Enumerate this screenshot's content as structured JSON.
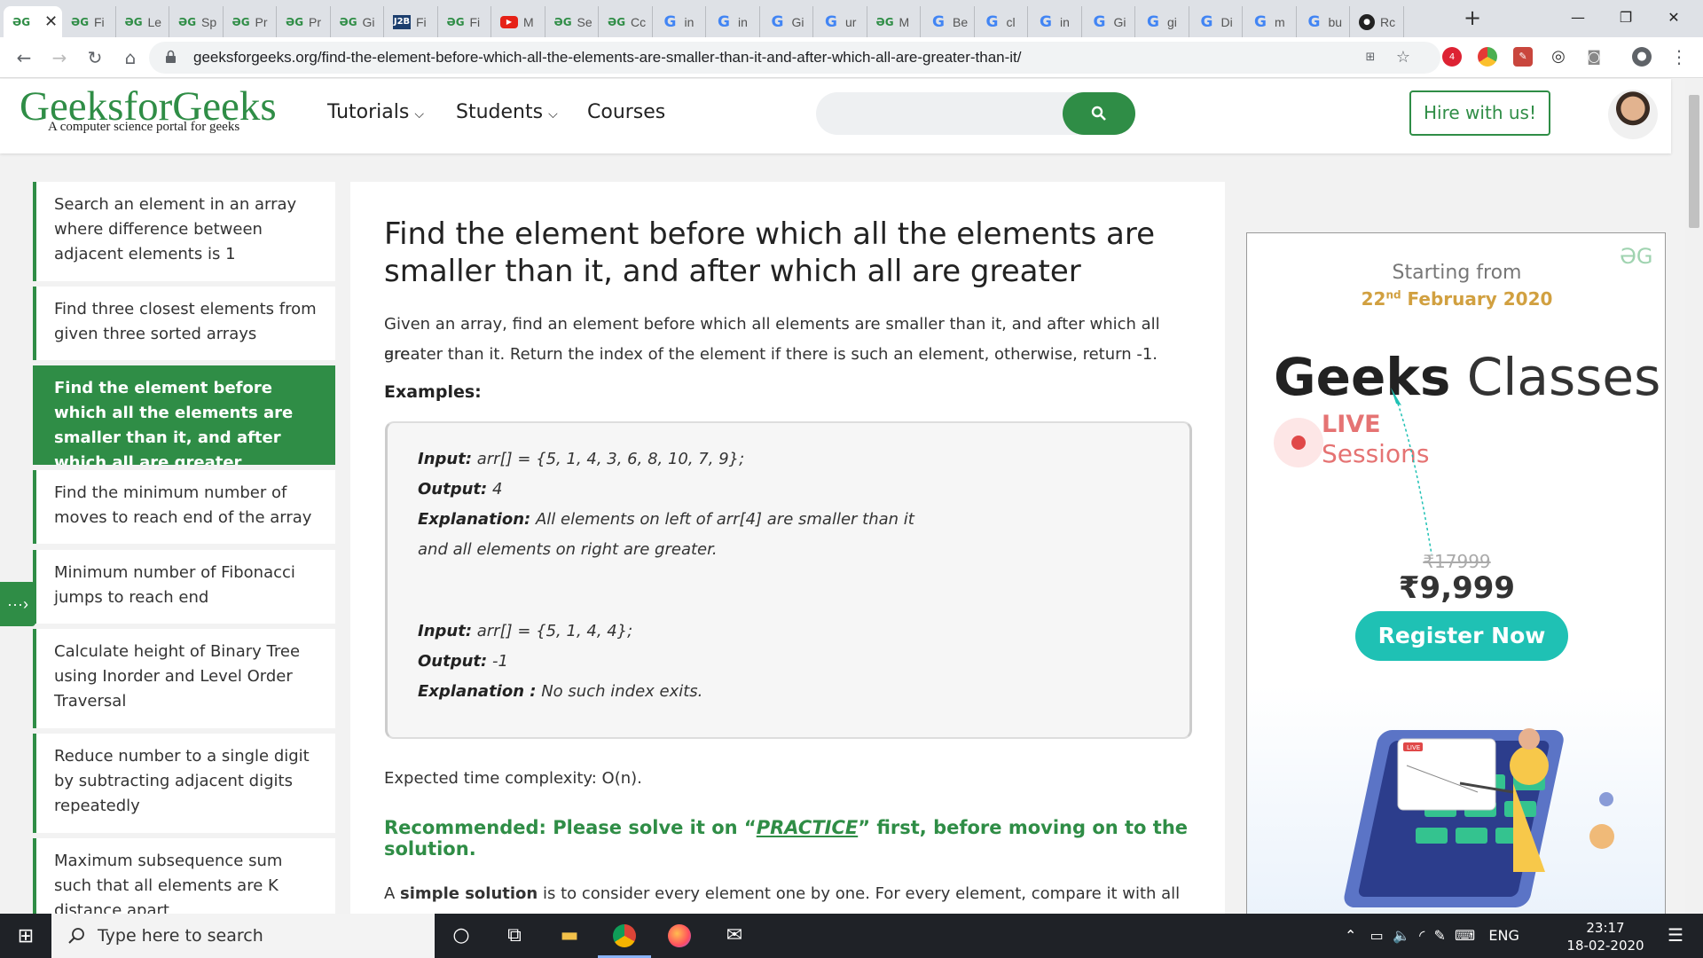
{
  "browser": {
    "tabs": [
      {
        "favicon": "gfg-icon",
        "title": "GG",
        "close": "✕",
        "active": true
      },
      {
        "favicon": "gfg-icon",
        "title": "Fi"
      },
      {
        "favicon": "gfg-icon",
        "title": "Le"
      },
      {
        "favicon": "gfg-icon",
        "title": "Sp"
      },
      {
        "favicon": "gfg-icon",
        "title": "Pr"
      },
      {
        "favicon": "gfg-icon",
        "title": "Pr"
      },
      {
        "favicon": "gfg-icon",
        "title": "Gi"
      },
      {
        "favicon": "j2b-icon",
        "title": "Fi"
      },
      {
        "favicon": "gfg-icon",
        "title": "Fi"
      },
      {
        "favicon": "youtube-icon",
        "title": "M"
      },
      {
        "favicon": "gfg-icon",
        "title": "Se"
      },
      {
        "favicon": "gfg-icon",
        "title": "Cc"
      },
      {
        "favicon": "google-icon",
        "title": "in"
      },
      {
        "favicon": "google-icon",
        "title": "in"
      },
      {
        "favicon": "google-icon",
        "title": "Gi"
      },
      {
        "favicon": "google-icon",
        "title": "ur"
      },
      {
        "favicon": "gfg-icon",
        "title": "M"
      },
      {
        "favicon": "google-icon",
        "title": "Be"
      },
      {
        "favicon": "google-icon",
        "title": "cl"
      },
      {
        "favicon": "google-icon",
        "title": "in"
      },
      {
        "favicon": "google-icon",
        "title": "Gi"
      },
      {
        "favicon": "google-icon",
        "title": "gi"
      },
      {
        "favicon": "google-icon",
        "title": "Di"
      },
      {
        "favicon": "google-icon",
        "title": "m"
      },
      {
        "favicon": "google-icon",
        "title": "bu"
      },
      {
        "favicon": "github-icon",
        "title": "Rc"
      }
    ],
    "new_tab": "+",
    "window": {
      "minimize": "—",
      "restore": "❐",
      "close": "✕"
    },
    "nav": {
      "back": "←",
      "forward": "→",
      "reload": "↻",
      "home": "⌂"
    },
    "url": "geeksforgeeks.org/find-the-element-before-which-all-the-elements-are-smaller-than-it-and-after-which-all-are-greater-than-it/",
    "extension_badge": "4",
    "menu": "⋮"
  },
  "site": {
    "logo": "GeeksforGeeks",
    "tagline": "A computer science portal for geeks",
    "menu": {
      "tutorials": "Tutorials",
      "students": "Students",
      "courses": "Courses"
    },
    "hire": "Hire with us!",
    "search_placeholder": ""
  },
  "sidebar": {
    "items": [
      {
        "label": "Search an element in an array where difference between adjacent elements is 1"
      },
      {
        "label": "Find three closest elements from given three sorted arrays"
      },
      {
        "label": "Find the element before which all the elements are smaller than it, and after which all are greater",
        "active": true
      },
      {
        "label": "Find the minimum number of moves to reach end of the array"
      },
      {
        "label": "Minimum number of Fibonacci jumps to reach end"
      },
      {
        "label": "Calculate height of Binary Tree using Inorder and Level Order Traversal"
      },
      {
        "label": "Reduce number to a single digit by subtracting adjacent digits repeatedly"
      },
      {
        "label": "Maximum subsequence sum such that all elements are K distance apart"
      }
    ],
    "toggle": "···›"
  },
  "article": {
    "title": "Find the element before which all the elements are smaller than it, and after which all are greater",
    "intro_line1": "Given an array, find an element before which all elements are smaller than it, and after which all are",
    "intro_line2": "greater than it. Return the index of the element if there is such an element, otherwise, return -1.",
    "examples_heading": "Examples:",
    "example1": {
      "input_label": "Input:",
      "input_value": " arr[] = {5, 1, 4, 3, 6, 8, 10, 7, 9};",
      "output_label": "Output:",
      "output_value": " 4",
      "explanation_label": "Explanation:",
      "explanation_value": " All elements on left of arr[4] are smaller than it",
      "explanation_line2": "and all elements on right are greater."
    },
    "example2": {
      "input_label": "Input:",
      "input_value": " arr[] = {5, 1, 4, 4};",
      "output_label": "Output:",
      "output_value": " -1",
      "explanation_label": "Explanation :",
      "explanation_value": " No such index exits."
    },
    "complexity": "Expected time complexity: O(n).",
    "recommended_prefix": "Recommended: Please solve it on “",
    "recommended_link": "PRACTICE",
    "recommended_suffix": "” first, before moving on to the solution.",
    "solution_prefix": "A ",
    "solution_bold": "simple solution",
    "solution_rest": " is to consider every element one by one. For every element, compare it with all"
  },
  "ad": {
    "logo": "ƏG",
    "starting": "Starting from",
    "date_day": "22",
    "date_sup": "nd",
    "date_rest": " February 2020",
    "brand_bold": "Geeks",
    "brand_rest": " Classes",
    "live": "LIVE",
    "sessions": "Sessions",
    "old_price": "₹17999",
    "price": "₹9,999",
    "cta": "Register Now",
    "screen_badge": "LIVE"
  },
  "taskbar": {
    "search_placeholder": "Type here to search",
    "language": "ENG",
    "time": "23:17",
    "date": "18-02-2020"
  },
  "colors": {
    "brand": "#2f8d46",
    "ad_teal": "#1fc1b4",
    "ad_gold": "#d1a040",
    "live_red": "#e04848"
  }
}
